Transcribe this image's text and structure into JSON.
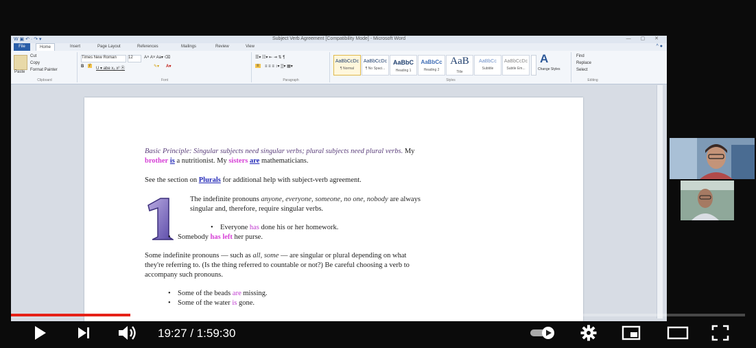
{
  "word": {
    "title": "Subject Verb Agreement [Compatibility Mode] - Microsoft Word",
    "tabs": [
      "File",
      "Home",
      "Insert",
      "Page Layout",
      "References",
      "Mailings",
      "Review",
      "View"
    ],
    "clipboard_label": "Clipboard",
    "font_label": "Font",
    "paragraph_label": "Paragraph",
    "styles_label": "Styles",
    "editing_label": "Editing",
    "paste_label": "Paste",
    "cut_label": "Cut",
    "copy_label": "Copy",
    "format_painter_label": "Format Painter",
    "font_name": "Times New Roman",
    "font_size": "12",
    "styles": [
      {
        "preview": "AaBbCcDc",
        "name": "¶ Normal"
      },
      {
        "preview": "AaBbCcDc",
        "name": "¶ No Spaci..."
      },
      {
        "preview": "AaBbC",
        "name": "Heading 1"
      },
      {
        "preview": "AaBbCc",
        "name": "Heading 2"
      },
      {
        "preview": "AaB",
        "name": "Title"
      },
      {
        "preview": "AaBbCc",
        "name": "Subtitle"
      },
      {
        "preview": "AaBbCcDc",
        "name": "Subtle Em..."
      }
    ],
    "change_styles": "Change Styles",
    "find": "Find",
    "replace": "Replace",
    "select": "Select"
  },
  "doc": {
    "basic_principle": "Basic Principle: Singular subjects need singular verbs; plural subjects need plural verbs.",
    "my": " My",
    "brother": "brother",
    "is": "is",
    "nutritionist": " a nutritionist. My ",
    "sisters": "sisters",
    "are": "are",
    "mathematicians": " mathematicians.",
    "see_section": "See the section on ",
    "plurals": "Plurals",
    "see_rest": " for additional help with subject-verb agreement.",
    "indef_1": "The indefinite pronouns ",
    "indef_list": "anyone, everyone, someone, no one, nobody",
    "indef_2": " are always",
    "indef_3": "singular and, therefore, require singular verbs.",
    "everyone": "Everyone ",
    "has": "has",
    "everyone_rest": " done his or her homework.",
    "somebody": "Somebody ",
    "has_left": "has left",
    "somebody_rest": " her purse.",
    "some_1": "Some indefinite pronouns — such as ",
    "some_all": "all, some",
    "some_2": " — are singular or plural depending on what",
    "some_3": "they're referring to. (Is the thing referred to countable or not?) Be careful choosing a verb to",
    "some_4": "accompany such pronouns.",
    "beads_1": "Some of the beads ",
    "beads_are": "are",
    "beads_2": " missing.",
    "water_1": "Some of the water ",
    "water_is": "is",
    "water_2": " gone."
  },
  "player": {
    "time": "19:27 / 1:59:30",
    "progress_fraction": 0.163,
    "accent": "#e62117"
  }
}
